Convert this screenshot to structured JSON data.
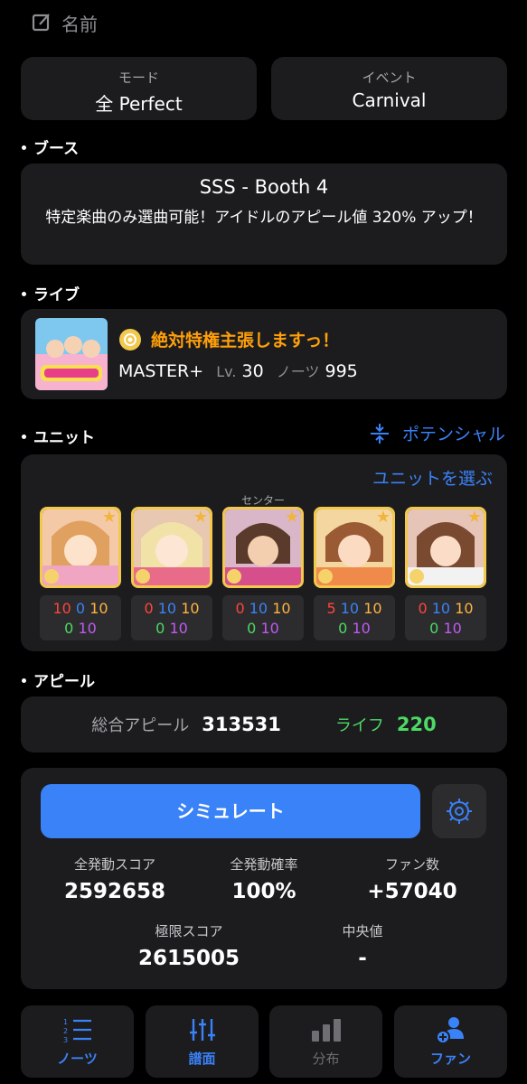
{
  "header": {
    "name_placeholder": "名前"
  },
  "mode": {
    "label": "モード",
    "value": "全 Perfect"
  },
  "event": {
    "label": "イベント",
    "value": "Carnival"
  },
  "sections": {
    "booth": "ブース",
    "live": "ライブ",
    "unit": "ユニット",
    "appeal": "アピール"
  },
  "booth": {
    "title": "SSS - Booth 4",
    "description": "特定楽曲のみ選曲可能！アイドルのアピール値 320% アップ！"
  },
  "live": {
    "song_title": "絶対特権主張しますっ！",
    "difficulty": "MASTER+",
    "level_label": "Lv.",
    "level": "30",
    "notes_label": "ノーツ",
    "notes": "995"
  },
  "unit": {
    "potential_label": "ポテンシャル",
    "choose_label": "ユニットを選ぶ",
    "center_label": "センター",
    "idols": [
      {
        "a": "10",
        "b": "0",
        "c": "10",
        "d": "0",
        "e": "10"
      },
      {
        "a": "0",
        "b": "10",
        "c": "10",
        "d": "0",
        "e": "10"
      },
      {
        "a": "0",
        "b": "10",
        "c": "10",
        "d": "0",
        "e": "10"
      },
      {
        "a": "5",
        "b": "10",
        "c": "10",
        "d": "0",
        "e": "10"
      },
      {
        "a": "0",
        "b": "10",
        "c": "10",
        "d": "0",
        "e": "10"
      }
    ]
  },
  "appeal": {
    "total_label": "総合アピール",
    "total_value": "313531",
    "life_label": "ライフ",
    "life_value": "220"
  },
  "simulation": {
    "button_label": "シミュレート",
    "full_combo_score_label": "全発動スコア",
    "full_combo_score": "2592658",
    "full_rate_label": "全発動確率",
    "full_rate": "100%",
    "fans_label": "ファン数",
    "fans": "+57040",
    "max_score_label": "極限スコア",
    "max_score": "2615005",
    "median_label": "中央値",
    "median": "-"
  },
  "tabs": [
    {
      "label": "ノーツ",
      "active": true
    },
    {
      "label": "譜面",
      "active": true
    },
    {
      "label": "分布",
      "active": false
    },
    {
      "label": "ファン",
      "active": true
    }
  ],
  "colors": {
    "accent": "#3a82f7",
    "song": "#ff9f0a",
    "life": "#4cd964"
  }
}
